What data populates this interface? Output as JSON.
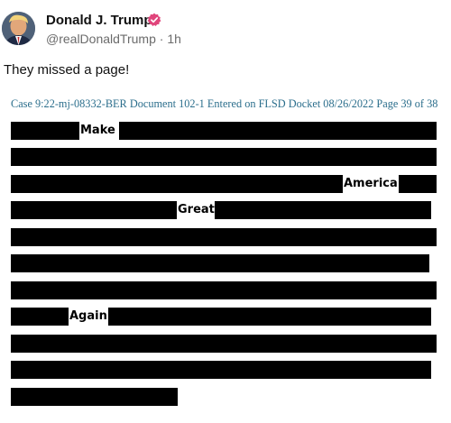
{
  "post": {
    "author_name": "Donald J. Trump",
    "handle": "@realDonaldTrump",
    "separator": "·",
    "time_ago": "1h",
    "text": "They missed a page!",
    "badge_color": "#e0457b"
  },
  "document": {
    "header": "Case 9:22-mj-08332-BER Document 102-1 Entered on FLSD Docket 08/26/2022 Page 39 of 38",
    "header_color": "#2b6e8c",
    "revealed_words": {
      "w1": "Make",
      "w2": "America",
      "w3": "Great",
      "w4": "Again"
    }
  }
}
